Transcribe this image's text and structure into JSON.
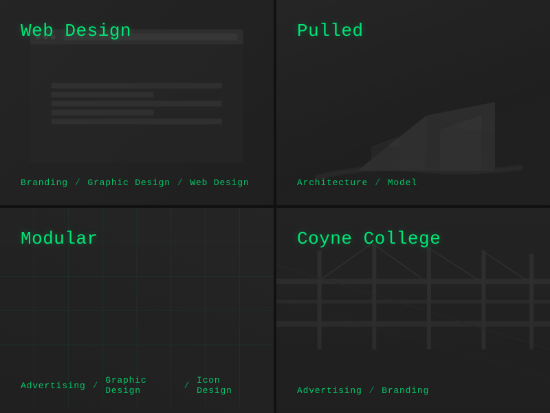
{
  "grid": {
    "gap_color": "#111111",
    "background": "#111111"
  },
  "cards": [
    {
      "id": "web-design",
      "title": "Web Design",
      "tags": [
        "Branding",
        "Graphic Design",
        "Web Design"
      ],
      "type": "browser-mockup"
    },
    {
      "id": "pulled",
      "title": "Pulled",
      "tags": [
        "Architecture",
        "Model"
      ],
      "type": "architecture"
    },
    {
      "id": "modular",
      "title": "Modular",
      "tags": [
        "Advertising",
        "Graphic Design",
        "Icon Design"
      ],
      "type": "grid-pattern"
    },
    {
      "id": "coyne-college",
      "title": "Coyne College",
      "tags": [
        "Advertising",
        "Branding"
      ],
      "type": "infrastructure"
    }
  ],
  "accent_color": "#00e676",
  "separator": "/"
}
